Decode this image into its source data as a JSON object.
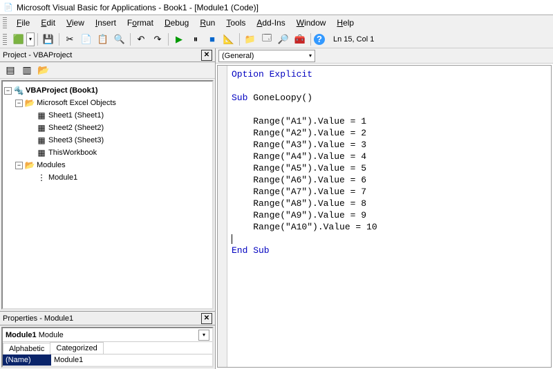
{
  "title": "Microsoft Visual Basic for Applications - Book1 - [Module1 (Code)]",
  "menus": [
    {
      "label": "File",
      "key": "F"
    },
    {
      "label": "Edit",
      "key": "E"
    },
    {
      "label": "View",
      "key": "V"
    },
    {
      "label": "Insert",
      "key": "I"
    },
    {
      "label": "Format",
      "key": "o"
    },
    {
      "label": "Debug",
      "key": "D"
    },
    {
      "label": "Run",
      "key": "R"
    },
    {
      "label": "Tools",
      "key": "T"
    },
    {
      "label": "Add-Ins",
      "key": "A"
    },
    {
      "label": "Window",
      "key": "W"
    },
    {
      "label": "Help",
      "key": "H"
    }
  ],
  "cursor_status": "Ln 15, Col 1",
  "project_panel": {
    "title": "Project - VBAProject",
    "root": "VBAProject (Book1)",
    "excel_folder": "Microsoft Excel Objects",
    "sheets": [
      "Sheet1 (Sheet1)",
      "Sheet2 (Sheet2)",
      "Sheet3 (Sheet3)",
      "ThisWorkbook"
    ],
    "modules_folder": "Modules",
    "module": "Module1"
  },
  "properties_panel": {
    "title": "Properties - Module1",
    "combo": "Module1 Module",
    "tabs": [
      "Alphabetic",
      "Categorized"
    ],
    "row_key": "(Name)",
    "row_val": "Module1"
  },
  "code_pane": {
    "object_combo": "(General)",
    "option_line": "Option Explicit",
    "sub_line": "Sub GoneLoopy()",
    "body": [
      "Range(\"A1\").Value = 1",
      "Range(\"A2\").Value = 2",
      "Range(\"A3\").Value = 3",
      "Range(\"A4\").Value = 4",
      "Range(\"A5\").Value = 5",
      "Range(\"A6\").Value = 6",
      "Range(\"A7\").Value = 7",
      "Range(\"A8\").Value = 8",
      "Range(\"A9\").Value = 9",
      "Range(\"A10\").Value = 10"
    ],
    "end_line": "End Sub"
  },
  "icons": {
    "app": "📄",
    "excel": "🟩",
    "save": "💾",
    "cut": "✂",
    "copy": "📄",
    "paste": "📋",
    "find": "🔍",
    "undo": "↶",
    "redo": "↷",
    "play": "▶",
    "pause": "⏸",
    "stop": "■",
    "design": "📐",
    "proj": "📁",
    "props": "🗔",
    "browser": "🔎",
    "toolbox": "🧰",
    "help": "?",
    "folder": "📂",
    "sheet": "▦",
    "module": "⋮",
    "viewcode": "▤",
    "viewobj": "▥"
  }
}
